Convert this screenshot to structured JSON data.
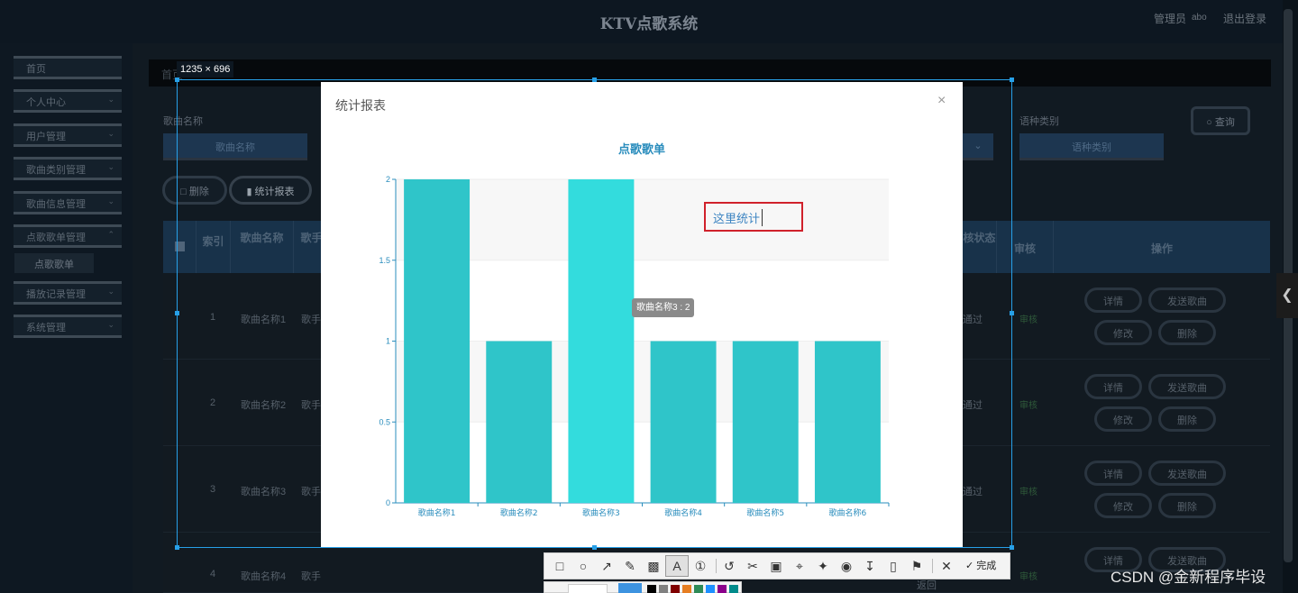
{
  "header": {
    "title": "KTV点歌系统",
    "admin_label": "管理员",
    "username": "abo",
    "logout": "退出登录"
  },
  "sidebar": {
    "items": [
      {
        "label": "首页",
        "has_arrow": false
      },
      {
        "label": "个人中心",
        "has_arrow": true
      },
      {
        "label": "用户管理",
        "has_arrow": true
      },
      {
        "label": "歌曲类别管理",
        "has_arrow": true
      },
      {
        "label": "歌曲信息管理",
        "has_arrow": true
      },
      {
        "label": "点歌歌单管理",
        "has_arrow": true
      },
      {
        "label": "播放记录管理",
        "has_arrow": true
      },
      {
        "label": "系统管理",
        "has_arrow": true
      }
    ],
    "active_sub": "点歌歌单"
  },
  "breadcrumb": "首页",
  "search": {
    "song_name_label": "歌曲名称",
    "song_name_placeholder": "歌曲名称",
    "language_label": "语种类别",
    "language_placeholder": "语种类别",
    "query_button": "查询"
  },
  "actions": {
    "delete": "删除",
    "stats": "统计报表"
  },
  "table": {
    "headers": [
      "索引",
      "歌曲名称",
      "歌手",
      "审核状态",
      "审核",
      "操作"
    ],
    "rows": [
      {
        "index": "1",
        "song": "歌曲名称1",
        "singer": "歌手",
        "status": "通过",
        "review": "审核"
      },
      {
        "index": "2",
        "song": "歌曲名称2",
        "singer": "歌手",
        "status": "通过",
        "review": "审核"
      },
      {
        "index": "3",
        "song": "歌曲名称3",
        "singer": "歌手",
        "status": "通过",
        "review": "审核"
      },
      {
        "index": "4",
        "song": "歌曲名称4",
        "singer": "歌手",
        "status": "返回",
        "review": "审核"
      }
    ],
    "ops": {
      "detail": "详情",
      "send": "发送歌曲",
      "edit": "修改",
      "delete": "删除"
    }
  },
  "screenshot_tool": {
    "size_label": "1235 × 696",
    "done_label": "完成",
    "selection_color": "#27a0e8",
    "palette": [
      "#000000",
      "#808080",
      "#800000",
      "#e67e22",
      "#2e8b57",
      "#1e90ff",
      "#8b008b",
      "#008b8b"
    ]
  },
  "modal": {
    "title": "统计报表",
    "close": "×"
  },
  "annotation": {
    "text": "这里统计",
    "border_color": "#d0212b"
  },
  "tooltip": "歌曲名称3 : 2",
  "chart_data": {
    "type": "bar",
    "title": "点歌歌单",
    "categories": [
      "歌曲名称1",
      "歌曲名称2",
      "歌曲名称3",
      "歌曲名称4",
      "歌曲名称5",
      "歌曲名称6"
    ],
    "values": [
      2,
      1,
      2,
      1,
      1,
      1
    ],
    "ylim": [
      0,
      2
    ],
    "yticks": [
      "0",
      "0.5",
      "1",
      "1.5",
      "2"
    ],
    "bar_color": "#2fc5c9",
    "highlight_color": "#33dcdd",
    "highlight_index": 2,
    "grid": true
  },
  "watermark": "CSDN @金新程序毕设"
}
